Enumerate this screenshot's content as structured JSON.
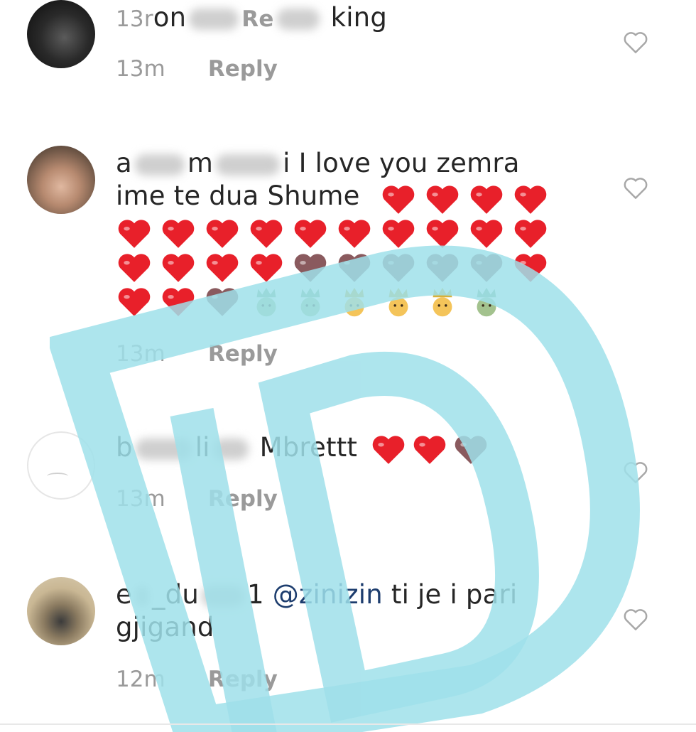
{
  "comments": [
    {
      "id": "c1",
      "username": "on",
      "text": "king",
      "time": "13m",
      "reply": "Reply",
      "overlap_time": "13r",
      "overlap_reply": "Re"
    },
    {
      "id": "c2",
      "username": "a",
      "text": "I love you zemra",
      "text2": "ime te dua Shume",
      "time": "13m",
      "reply": "Reply",
      "emoji_rows": [
        [
          "red",
          "red",
          "red",
          "red"
        ],
        [
          "red",
          "red",
          "red",
          "red",
          "red",
          "red",
          "red",
          "red",
          "red",
          "red"
        ],
        [
          "red",
          "red",
          "red",
          "red",
          "faded",
          "faded",
          "faded",
          "faded",
          "faded",
          "red"
        ],
        [
          "red",
          "red",
          "faded",
          "prince-green",
          "prince-green",
          "prince",
          "prince",
          "prince",
          "prince-green"
        ]
      ]
    },
    {
      "id": "c3",
      "username": "b",
      "text": "Mbrettt",
      "time": "13m",
      "reply": "Reply",
      "emojis": [
        "red",
        "red",
        "faded"
      ]
    },
    {
      "id": "c4",
      "username": "e",
      "username_mid": "_du",
      "username_end": "1",
      "mention": "@zinizin",
      "text": "ti je i pari",
      "text2": "gjigand",
      "time": "12m",
      "reply": "Reply"
    }
  ],
  "icons": {
    "like": "heart-outline-icon",
    "emoji_heart": "red-heart-icon",
    "emoji_prince": "prince-icon"
  },
  "colors": {
    "text": "#262626",
    "meta": "#9a9a9a",
    "mention": "#1d3d6e",
    "heart": "#e8202a",
    "watermark": "#9fe0ea"
  }
}
